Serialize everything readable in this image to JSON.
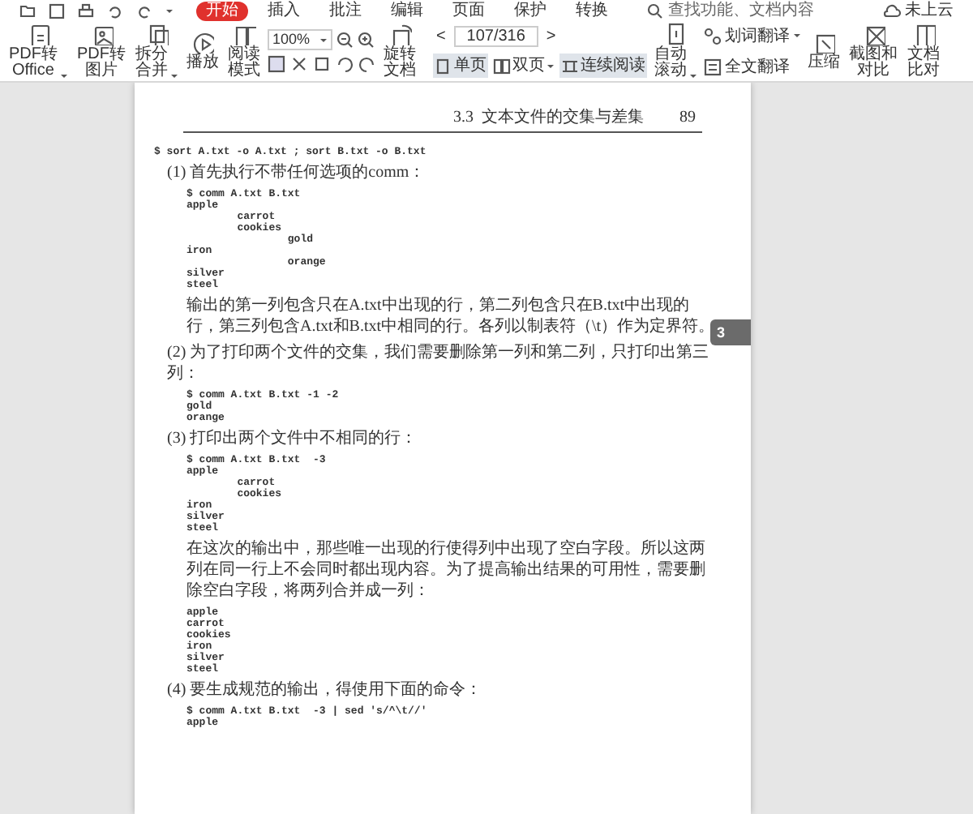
{
  "menu_tabs": [
    {
      "label": "开始",
      "selected": true
    },
    {
      "label": "插入",
      "selected": false
    },
    {
      "label": "批注",
      "selected": false
    },
    {
      "label": "编辑",
      "selected": false
    },
    {
      "label": "页面",
      "selected": false
    },
    {
      "label": "保护",
      "selected": false
    },
    {
      "label": "转换",
      "selected": false
    }
  ],
  "search": {
    "placeholder": "查找功能、文档内容"
  },
  "cloud_status": "未上云",
  "toolbar_left": [
    {
      "label": "PDF转Office",
      "dropdown": true
    },
    {
      "label": "PDF转图片",
      "dropdown": false
    },
    {
      "label": "拆分合并",
      "dropdown": true
    },
    {
      "label": "播放",
      "dropdown": false
    },
    {
      "label": "阅读模式",
      "dropdown": false
    }
  ],
  "zoom": {
    "value": "100%"
  },
  "rotate_label": "旋转文档",
  "page_nav": {
    "prev": "<",
    "value": "107/316",
    "next": ">"
  },
  "view_modes": [
    {
      "label": "单页",
      "selected": true,
      "dropdown": false
    },
    {
      "label": "双页",
      "selected": false,
      "dropdown": true
    },
    {
      "label": "连续阅读",
      "selected": true,
      "dropdown": false
    }
  ],
  "auto_scroll": {
    "label": "自动滚动",
    "dropdown": true
  },
  "translate": [
    {
      "label": "划词翻译",
      "dropdown": true
    },
    {
      "label": "全文翻译",
      "dropdown": false
    }
  ],
  "toolbar_right": [
    {
      "label": "压缩"
    },
    {
      "label": "截图和对比"
    },
    {
      "label": "文档比对"
    }
  ],
  "page": {
    "header_title": "3.3  文本文件的交集与差集",
    "page_number": "89",
    "side_tab": "3",
    "blocks": [
      {
        "kind": "code",
        "indent": false,
        "lines": [
          "$ sort A.txt -o A.txt ; sort B.txt -o B.txt"
        ]
      },
      {
        "kind": "para",
        "indent": false,
        "text": "(1) 首先执行不带任何选项的comm："
      },
      {
        "kind": "code",
        "indent": true,
        "lines": [
          "$ comm A.txt B.txt",
          "apple",
          "        carrot",
          "        cookies",
          "                gold",
          "iron",
          "                orange",
          "silver",
          "steel"
        ]
      },
      {
        "kind": "para",
        "indent": true,
        "text": "输出的第一列包含只在A.txt中出现的行，第二列包含只在B.txt中出现的行，第三列包含A.txt和B.txt中相同的行。各列以制表符（\\t）作为定界符。"
      },
      {
        "kind": "para",
        "indent": false,
        "text": "(2) 为了打印两个文件的交集，我们需要删除第一列和第二列，只打印出第三列："
      },
      {
        "kind": "code",
        "indent": true,
        "lines": [
          "$ comm A.txt B.txt -1 -2",
          "gold",
          "orange"
        ]
      },
      {
        "kind": "para",
        "indent": false,
        "text": "(3) 打印出两个文件中不相同的行："
      },
      {
        "kind": "code",
        "indent": true,
        "lines": [
          "$ comm A.txt B.txt  -3",
          "apple",
          "        carrot",
          "        cookies",
          "iron",
          "silver",
          "steel"
        ]
      },
      {
        "kind": "para",
        "indent": true,
        "text": "在这次的输出中，那些唯一出现的行使得列中出现了空白字段。所以这两列在同一行上不会同时都出现内容。为了提高输出结果的可用性，需要删除空白字段，将两列合并成一列："
      },
      {
        "kind": "code",
        "indent": true,
        "lines": [
          "apple",
          "carrot",
          "cookies",
          "iron",
          "silver",
          "steel"
        ]
      },
      {
        "kind": "para",
        "indent": false,
        "text": "(4) 要生成规范的输出，得使用下面的命令："
      },
      {
        "kind": "code",
        "indent": true,
        "lines": [
          "$ comm A.txt B.txt  -3 | sed 's/^\\t//'",
          "apple"
        ]
      }
    ]
  }
}
